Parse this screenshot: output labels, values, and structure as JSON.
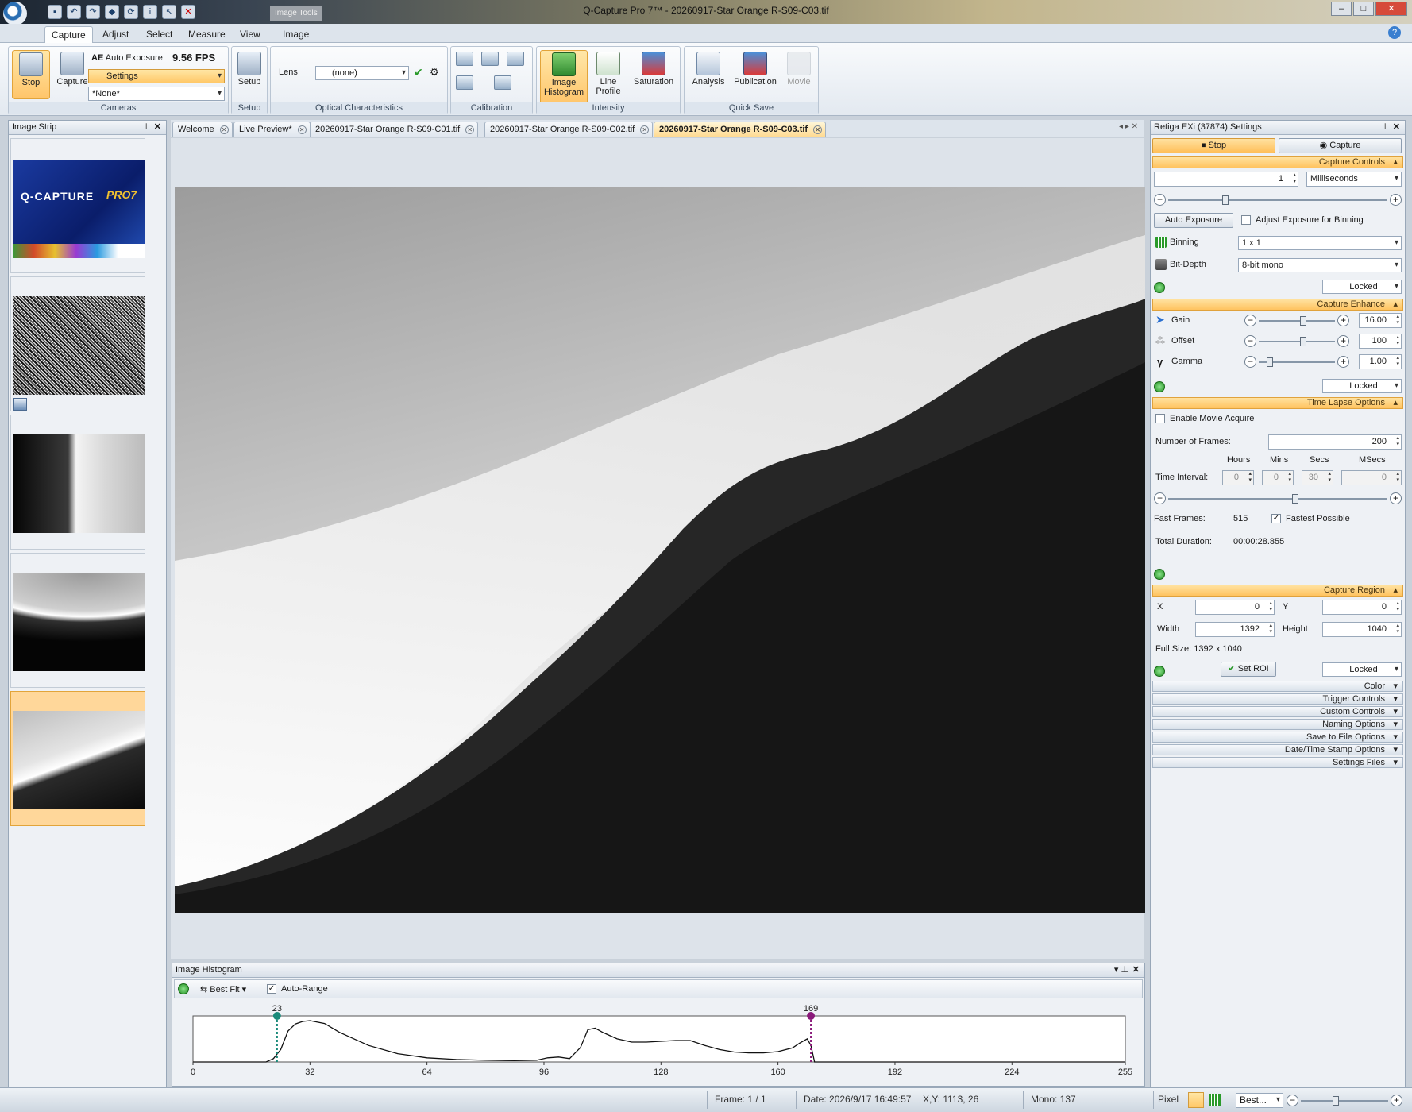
{
  "window": {
    "title": "Q-Capture Pro 7™ - 20260917-Star Orange R-S09-C03.tif",
    "context_tab": "Image Tools"
  },
  "ribbon_tabs": [
    "Capture",
    "Adjust",
    "Select",
    "Measure",
    "View",
    "Image"
  ],
  "cameras": {
    "stop": "Stop",
    "capture": "Capture",
    "auto_exposure": "Auto Exposure",
    "fps": "9.56 FPS",
    "settings": "Settings",
    "preset": "*None*",
    "caption": "Cameras"
  },
  "setup": {
    "label": "Setup",
    "caption": "Setup"
  },
  "optical": {
    "lens_label": "Lens",
    "lens_value": "(none)",
    "caption": "Optical Characteristics"
  },
  "calibration": {
    "caption": "Calibration"
  },
  "intensity": {
    "histogram": "Image Histogram",
    "line_profile": "Line Profile",
    "saturation": "Saturation",
    "caption": "Intensity"
  },
  "quick_save": {
    "analysis": "Analysis",
    "publication": "Publication",
    "movie": "Movie",
    "caption": "Quick Save"
  },
  "image_strip": {
    "title": "Image Strip",
    "splash_brand": "Q-CAPTURE",
    "splash_pro": "PRO7"
  },
  "doc_tabs": [
    "Welcome",
    "Live Preview*",
    "20260917-Star Orange R-S09-C01.tif",
    "20260917-Star Orange R-S09-C02.tif",
    "20260917-Star Orange R-S09-C03.tif"
  ],
  "settings": {
    "title": "Retiga EXi (37874) Settings",
    "stop": "Stop",
    "capture": "Capture",
    "capture_controls": {
      "title": "Capture Controls",
      "exposure": "1",
      "unit": "Milliseconds",
      "auto_exposure": "Auto Exposure",
      "adjust_binning": "Adjust Exposure for Binning",
      "binning_label": "Binning",
      "binning": "1 x 1",
      "bitdepth_label": "Bit-Depth",
      "bitdepth": "8-bit mono",
      "locked": "Locked"
    },
    "capture_enhance": {
      "title": "Capture Enhance",
      "gain_label": "Gain",
      "gain": "16.00",
      "offset_label": "Offset",
      "offset": "100",
      "gamma_label": "Gamma",
      "gamma": "1.00",
      "locked": "Locked"
    },
    "time_lapse": {
      "title": "Time Lapse Options",
      "enable_movie": "Enable Movie Acquire",
      "frames_label": "Number of Frames:",
      "frames": "200",
      "hours_h": "Hours",
      "mins_h": "Mins",
      "secs_h": "Secs",
      "msecs_h": "MSecs",
      "interval_label": "Time Interval:",
      "hours": "0",
      "mins": "0",
      "secs": "30",
      "msecs": "0",
      "fast_label": "Fast Frames:",
      "fast": "515",
      "fastest": "Fastest Possible",
      "duration_label": "Total Duration:",
      "duration": "00:00:28.855"
    },
    "capture_region": {
      "title": "Capture Region",
      "x_label": "X",
      "x": "0",
      "y_label": "Y",
      "y": "0",
      "width_label": "Width",
      "width": "1392",
      "height_label": "Height",
      "height": "1040",
      "full_size": "Full Size: 1392 x 1040",
      "set_roi": "Set ROI",
      "locked": "Locked"
    },
    "collapsed": [
      "Color",
      "Trigger Controls",
      "Custom Controls",
      "Naming Options",
      "Save to File Options",
      "Date/Time Stamp Options",
      "Settings Files"
    ]
  },
  "histogram": {
    "title": "Image Histogram",
    "best_fit": "Best Fit",
    "auto_range": "Auto-Range",
    "low_marker": "23",
    "high_marker": "169",
    "low_color": "#1a8a7a",
    "high_color": "#8a1a7a",
    "ticks": [
      "0",
      "32",
      "64",
      "96",
      "128",
      "160",
      "192",
      "224",
      "255"
    ]
  },
  "chart_data": {
    "type": "line",
    "title": "Image Histogram",
    "xlabel": "",
    "ylabel": "",
    "xlim": [
      0,
      255
    ],
    "x": [
      0,
      20,
      22,
      24,
      26,
      28,
      30,
      32,
      36,
      40,
      48,
      56,
      64,
      72,
      80,
      88,
      94,
      97,
      100,
      103,
      106,
      108,
      110,
      112,
      116,
      120,
      124,
      128,
      132,
      136,
      140,
      144,
      148,
      152,
      156,
      160,
      164,
      166,
      168,
      169,
      170,
      255
    ],
    "y": [
      0,
      0,
      0.08,
      0.3,
      0.75,
      0.92,
      0.98,
      1.0,
      0.93,
      0.72,
      0.4,
      0.2,
      0.1,
      0.06,
      0.04,
      0.03,
      0.04,
      0.1,
      0.12,
      0.08,
      0.35,
      0.78,
      0.82,
      0.72,
      0.56,
      0.48,
      0.48,
      0.5,
      0.52,
      0.52,
      0.4,
      0.3,
      0.24,
      0.22,
      0.22,
      0.25,
      0.34,
      0.46,
      0.56,
      0.4,
      0,
      0
    ],
    "markers": [
      23,
      169
    ]
  },
  "statusbar": {
    "frame": "Frame: 1 / 1",
    "date": "Date: 2026/9/17 16:49:57",
    "xy": "X,Y: 1113,   26",
    "mono": "Mono:  137",
    "pixel": "Pixel",
    "zoom": "Best..."
  }
}
